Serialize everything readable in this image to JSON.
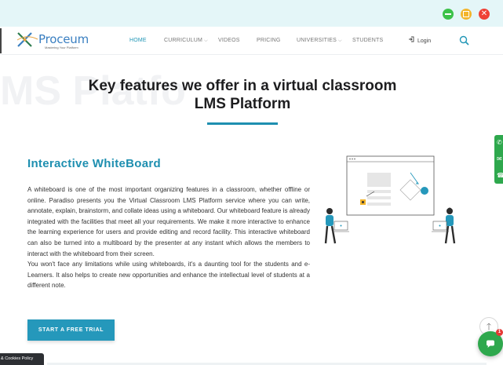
{
  "window": {
    "controls": {
      "minimize_icon": "minimize-icon",
      "maximize_icon": "maximize-icon",
      "close_icon": "close-icon",
      "close_glyph": "✕"
    },
    "colors": {
      "titlebar": "#e4f6f8",
      "minimize": "#3cc24a",
      "maximize": "#f3b52c",
      "close": "#ef4136"
    }
  },
  "header": {
    "logo": {
      "name": "Proceum",
      "tagline": "Mastering Your Platform",
      "icon": "proceum-logo-icon"
    },
    "nav": [
      {
        "label": "HOME",
        "active": true,
        "dropdown": false
      },
      {
        "label": "CURRICULUM",
        "active": false,
        "dropdown": true
      },
      {
        "label": "VIDEOS",
        "active": false,
        "dropdown": false
      },
      {
        "label": "PRICING",
        "active": false,
        "dropdown": false
      },
      {
        "label": "UNIVERSITIES",
        "active": false,
        "dropdown": true
      },
      {
        "label": "STUDENTS",
        "active": false,
        "dropdown": false
      }
    ],
    "dropdown_glyph": "⌵",
    "login_label": "Login",
    "search_icon": "search-icon"
  },
  "hero": {
    "ghost_text": "MS Platfo",
    "title_line1": "Key features we offer in a virtual classroom",
    "title_line2": "LMS Platform"
  },
  "feature": {
    "heading": "Interactive WhiteBoard",
    "paragraph1": "A whiteboard is one of the most important organizing features in a classroom, whether offline or online. Paradiso presents you the Virtual Classroom LMS Platform service where you can write, annotate, explain, brainstorm, and collate ideas using a whiteboard. Our whiteboard feature is already integrated with the facilities that meet all your requirements. We make it more interactive to enhance the learning experience for users and provide editing and record facility. This interactive whiteboard can also be turned into a multiboard by the presenter at any instant which allows the members to interact with the whiteboard from their screen.",
    "paragraph2": "You won't face any limitations while using whiteboards, it's a daunting tool for the students and e-Learners. It also helps to create new opportunities and enhance the intellectual level of students at a different note.",
    "cta_label": "START A FREE TRIAL",
    "illustration": "whiteboard-collaboration-illustration"
  },
  "floating": {
    "side_icons": [
      "whatsapp-icon",
      "mail-icon",
      "phone-icon"
    ],
    "scroll_top_glyph": "🡑",
    "chat_badge": "1",
    "chat_icon": "chat-icon"
  },
  "cookie": {
    "label": "& Cookies Policy"
  },
  "accent_color": "#2196b6"
}
